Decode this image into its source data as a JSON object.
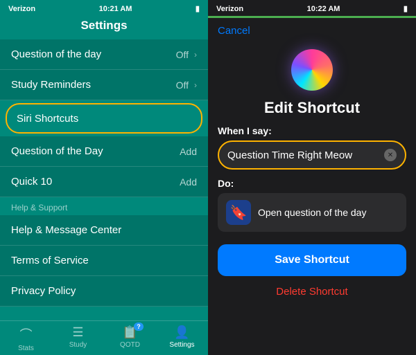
{
  "left": {
    "statusBar": {
      "carrier": "Verizon",
      "time": "10:21 AM",
      "wifi": "wifi",
      "battery": "battery"
    },
    "title": "Settings",
    "items": [
      {
        "id": "question-of-day",
        "label": "Question of the day",
        "value": "Off",
        "hasChevron": true,
        "type": "row"
      },
      {
        "id": "study-reminders",
        "label": "Study Reminders",
        "value": "Off",
        "hasChevron": true,
        "type": "row"
      },
      {
        "id": "siri-shortcuts",
        "label": "Siri Shortcuts",
        "value": "",
        "hasChevron": false,
        "type": "highlighted"
      },
      {
        "id": "question-of-day-2",
        "label": "Question of the Day",
        "value": "Add",
        "hasChevron": false,
        "type": "row"
      },
      {
        "id": "quick-10",
        "label": "Quick 10",
        "value": "Add",
        "hasChevron": false,
        "type": "row"
      }
    ],
    "sectionHeader": "Help & Support",
    "helpItems": [
      {
        "id": "help-center",
        "label": "Help & Message Center"
      },
      {
        "id": "terms",
        "label": "Terms of Service"
      },
      {
        "id": "privacy",
        "label": "Privacy Policy"
      }
    ],
    "nav": [
      {
        "id": "stats",
        "label": "Stats",
        "icon": "⌂",
        "active": false
      },
      {
        "id": "study",
        "label": "Study",
        "icon": "≔",
        "active": false
      },
      {
        "id": "qotd",
        "label": "QOTD",
        "icon": "📅",
        "active": false,
        "badge": "?"
      },
      {
        "id": "settings",
        "label": "Settings",
        "icon": "👤",
        "active": true
      }
    ]
  },
  "right": {
    "statusBar": {
      "carrier": "Verizon",
      "time": "10:22 AM"
    },
    "cancelLabel": "Cancel",
    "title": "Edit Shortcut",
    "whenLabel": "When I say:",
    "phrase": "Question Time Right Meow",
    "doLabel": "Do:",
    "doAction": "Open question of the day",
    "saveLabel": "Save Shortcut",
    "deleteLabel": "Delete Shortcut"
  }
}
